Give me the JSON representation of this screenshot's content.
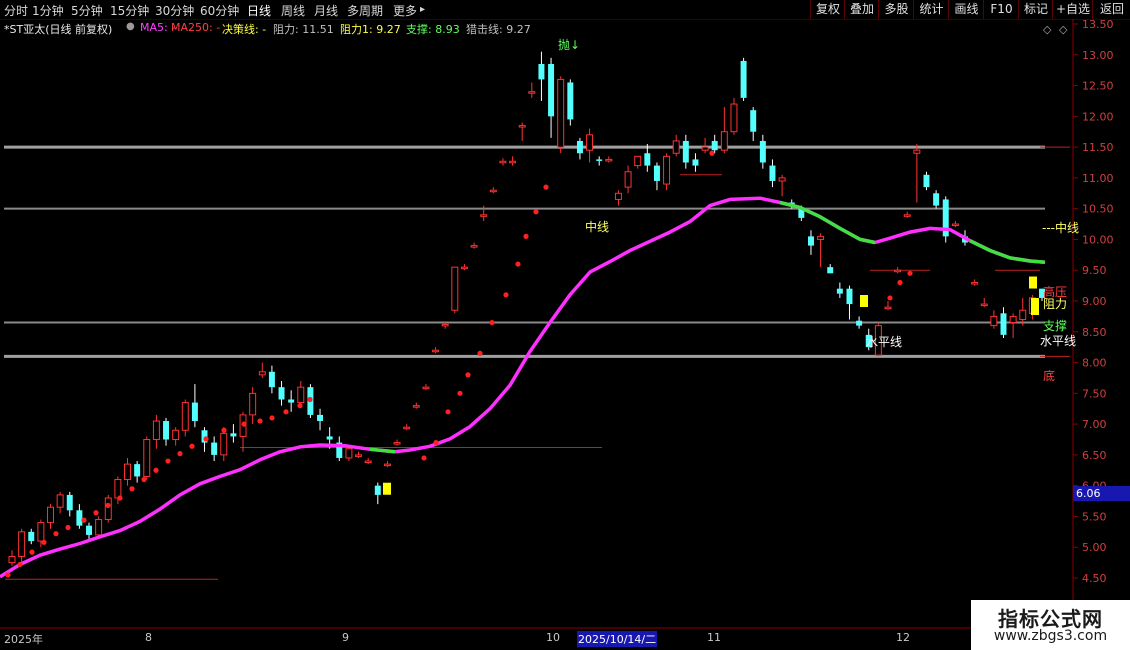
{
  "toolbar": {
    "timeframes": [
      "分时",
      "1分钟",
      "5分钟",
      "15分钟",
      "30分钟",
      "60分钟",
      "日线",
      "周线",
      "月线",
      "多周期",
      "更多"
    ],
    "active": "日线",
    "more_arrow": "▸",
    "right_buttons": [
      "复权",
      "叠加",
      "多股",
      "统计",
      "画线",
      "F10",
      "标记",
      "+自选",
      "返回"
    ]
  },
  "legend": {
    "stock": "*ST亚太(日线 前复权)",
    "ma5_label": "MA5: -",
    "ma250_label": "MA250: -",
    "decision_label": "决策线: -",
    "resist_label": "阻力: 11.51",
    "resist1_label": "阻力1: 9.27",
    "support_label": "支撑: 8.93",
    "snipe_label": "猎击线: 9.27"
  },
  "colors": {
    "background": "#000000",
    "up": "#ff3232",
    "down": "#54ffff",
    "ma": "#ff30ff",
    "ma_green": "#40e040",
    "hline": "#9a9a9a",
    "axis": "#8b0000",
    "yellow": "#ffff00"
  },
  "annotations": {
    "top_marker": "抛↓",
    "mid_line_label": "中线",
    "mid_line_right": "---中线",
    "level_label": "水平线",
    "level_right": "水平线",
    "high_press": "高压",
    "resist_right": "阻力",
    "support_right": "支撑",
    "bottom_right": "底"
  },
  "price_box": "6.06",
  "watermark": {
    "title": "指标公式网",
    "url": "www.zbgs3.com"
  },
  "x_axis": {
    "labels": [
      "2025年",
      "8",
      "9",
      "10",
      "11",
      "12"
    ],
    "highlight": "2025/10/14/二"
  },
  "chart_data": {
    "type": "candlestick",
    "y_ticks": [
      "13.50",
      "13.00",
      "12.50",
      "12.00",
      "11.50",
      "11.00",
      "10.50",
      "10.00",
      "9.50",
      "9.00",
      "8.50",
      "8.00",
      "7.50",
      "7.00",
      "6.50",
      "6.00",
      "5.50",
      "5.00",
      "4.50"
    ],
    "ylim": [
      4.3,
      13.65
    ],
    "h_lines": [
      11.5,
      10.5,
      8.65,
      8.1
    ],
    "candles": [
      [
        4.75,
        4.85,
        4.7,
        4.95
      ],
      [
        4.85,
        5.25,
        4.7,
        5.3
      ],
      [
        5.25,
        5.1,
        5.05,
        5.3
      ],
      [
        5.1,
        5.4,
        5.0,
        5.45
      ],
      [
        5.4,
        5.65,
        5.3,
        5.7
      ],
      [
        5.65,
        5.85,
        5.55,
        5.9
      ],
      [
        5.85,
        5.6,
        5.5,
        5.9
      ],
      [
        5.6,
        5.35,
        5.3,
        5.7
      ],
      [
        5.35,
        5.2,
        5.1,
        5.4
      ],
      [
        5.2,
        5.45,
        5.15,
        5.5
      ],
      [
        5.45,
        5.8,
        5.4,
        5.85
      ],
      [
        5.8,
        6.1,
        5.7,
        6.15
      ],
      [
        6.1,
        6.35,
        6.0,
        6.45
      ],
      [
        6.35,
        6.15,
        6.05,
        6.4
      ],
      [
        6.15,
        6.75,
        6.1,
        6.8
      ],
      [
        6.75,
        7.05,
        6.6,
        7.15
      ],
      [
        7.05,
        6.75,
        6.65,
        7.1
      ],
      [
        6.75,
        6.9,
        6.65,
        6.95
      ],
      [
        6.9,
        7.35,
        6.8,
        7.4
      ],
      [
        7.35,
        7.05,
        6.95,
        7.65
      ],
      [
        6.9,
        6.7,
        6.55,
        6.95
      ],
      [
        6.7,
        6.5,
        6.4,
        6.8
      ],
      [
        6.5,
        6.85,
        6.4,
        6.95
      ],
      [
        6.85,
        6.8,
        6.7,
        7.0
      ],
      [
        6.8,
        7.15,
        6.55,
        7.2
      ],
      [
        7.15,
        7.5,
        7.0,
        7.6
      ],
      [
        7.8,
        7.85,
        7.75,
        8.0
      ],
      [
        7.85,
        7.6,
        7.5,
        7.95
      ],
      [
        7.6,
        7.4,
        7.3,
        7.7
      ],
      [
        7.4,
        7.35,
        7.2,
        7.55
      ],
      [
        7.35,
        7.6,
        7.3,
        7.7
      ],
      [
        7.6,
        7.15,
        7.1,
        7.65
      ],
      [
        7.15,
        7.05,
        6.9,
        7.25
      ],
      [
        6.8,
        6.75,
        6.6,
        6.95
      ],
      [
        6.7,
        6.45,
        6.4,
        6.8
      ],
      [
        6.45,
        6.6,
        6.4,
        6.65
      ],
      [
        6.5,
        6.5,
        6.45,
        6.55
      ],
      [
        6.4,
        6.4,
        6.35,
        6.45
      ],
      [
        6.0,
        5.85,
        5.7,
        6.05
      ],
      [
        6.35,
        6.35,
        6.3,
        6.4
      ],
      [
        6.7,
        6.7,
        6.65,
        6.75
      ],
      [
        6.95,
        6.95,
        6.9,
        7.0
      ],
      [
        7.3,
        7.3,
        7.25,
        7.35
      ],
      [
        7.6,
        7.6,
        7.55,
        7.65
      ],
      [
        8.2,
        8.2,
        8.15,
        8.25
      ],
      [
        8.62,
        8.62,
        8.55,
        8.67
      ],
      [
        8.85,
        9.55,
        8.8,
        9.55
      ],
      [
        9.55,
        9.55,
        9.5,
        9.6
      ],
      [
        9.9,
        9.9,
        9.85,
        9.95
      ],
      [
        10.4,
        10.4,
        10.3,
        10.55
      ],
      [
        10.8,
        10.8,
        10.75,
        10.85
      ],
      [
        11.27,
        11.27,
        11.2,
        11.32
      ],
      [
        11.27,
        11.27,
        11.2,
        11.35
      ],
      [
        11.85,
        11.85,
        11.6,
        11.9
      ],
      [
        12.4,
        12.4,
        12.3,
        12.55
      ],
      [
        12.85,
        12.6,
        12.25,
        13.05
      ],
      [
        12.85,
        12.0,
        11.65,
        12.95
      ],
      [
        11.5,
        12.6,
        11.4,
        12.65
      ],
      [
        12.55,
        11.95,
        11.85,
        12.6
      ],
      [
        11.6,
        11.4,
        11.3,
        11.65
      ],
      [
        11.45,
        11.7,
        11.25,
        11.8
      ],
      [
        11.3,
        11.28,
        11.2,
        11.35
      ],
      [
        11.3,
        11.3,
        11.25,
        11.35
      ],
      [
        10.65,
        10.75,
        10.55,
        10.8
      ],
      [
        10.85,
        11.1,
        10.75,
        11.2
      ],
      [
        11.2,
        11.35,
        11.15,
        11.35
      ],
      [
        11.4,
        11.2,
        11.1,
        11.55
      ],
      [
        11.2,
        10.95,
        10.8,
        11.25
      ],
      [
        10.9,
        11.35,
        10.8,
        11.4
      ],
      [
        11.4,
        11.6,
        11.35,
        11.7
      ],
      [
        11.6,
        11.25,
        11.15,
        11.7
      ],
      [
        11.3,
        11.2,
        11.1,
        11.4
      ],
      [
        11.45,
        11.5,
        11.4,
        11.65
      ],
      [
        11.6,
        11.45,
        11.4,
        11.7
      ],
      [
        11.45,
        11.75,
        11.4,
        12.15
      ],
      [
        11.75,
        12.2,
        11.7,
        12.3
      ],
      [
        12.9,
        12.3,
        12.25,
        12.95
      ],
      [
        12.1,
        11.75,
        11.6,
        12.15
      ],
      [
        11.6,
        11.25,
        11.15,
        11.7
      ],
      [
        11.2,
        10.95,
        10.85,
        11.3
      ],
      [
        10.95,
        11.0,
        10.7,
        11.05
      ],
      [
        10.6,
        10.55,
        10.5,
        10.65
      ],
      [
        10.5,
        10.35,
        10.3,
        10.55
      ],
      [
        10.05,
        9.9,
        9.75,
        10.15
      ],
      [
        10.0,
        10.05,
        9.55,
        10.1
      ],
      [
        9.55,
        9.45,
        9.45,
        9.6
      ],
      [
        9.2,
        9.12,
        9.05,
        9.3
      ],
      [
        9.2,
        8.95,
        8.7,
        9.25
      ],
      [
        8.68,
        8.6,
        8.55,
        8.75
      ],
      [
        8.45,
        8.25,
        8.2,
        8.55
      ],
      [
        8.12,
        8.6,
        8.1,
        8.65
      ],
      [
        8.9,
        8.9,
        8.85,
        9.0
      ],
      [
        9.5,
        9.5,
        9.45,
        9.55
      ],
      [
        10.4,
        10.4,
        10.35,
        10.45
      ],
      [
        11.4,
        11.45,
        10.6,
        11.55
      ],
      [
        11.05,
        10.85,
        10.8,
        11.1
      ],
      [
        10.75,
        10.55,
        10.5,
        10.8
      ],
      [
        10.65,
        10.05,
        9.95,
        10.7
      ],
      [
        10.25,
        10.25,
        10.2,
        10.3
      ],
      [
        10.05,
        9.95,
        9.9,
        10.15
      ],
      [
        9.3,
        9.3,
        9.25,
        9.35
      ],
      [
        8.95,
        8.95,
        8.9,
        9.05
      ],
      [
        8.6,
        8.75,
        8.55,
        8.85
      ],
      [
        8.8,
        8.45,
        8.4,
        8.9
      ],
      [
        8.65,
        8.75,
        8.4,
        8.8
      ],
      [
        8.7,
        8.85,
        8.6,
        9.05
      ],
      [
        8.8,
        9.05,
        8.7,
        9.1
      ],
      [
        9.2,
        9.05,
        9.0,
        9.2
      ]
    ],
    "ma_line": [
      [
        0,
        4.52
      ],
      [
        20,
        4.72
      ],
      [
        40,
        4.87
      ],
      [
        60,
        4.97
      ],
      [
        80,
        5.06
      ],
      [
        100,
        5.17
      ],
      [
        120,
        5.27
      ],
      [
        140,
        5.42
      ],
      [
        160,
        5.62
      ],
      [
        180,
        5.85
      ],
      [
        200,
        6.03
      ],
      [
        220,
        6.15
      ],
      [
        240,
        6.26
      ],
      [
        260,
        6.42
      ],
      [
        280,
        6.55
      ],
      [
        300,
        6.63
      ],
      [
        320,
        6.66
      ],
      [
        345,
        6.65
      ],
      [
        370,
        6.59
      ],
      [
        395,
        6.55
      ],
      [
        410,
        6.58
      ],
      [
        430,
        6.64
      ],
      [
        450,
        6.76
      ],
      [
        470,
        6.96
      ],
      [
        490,
        7.25
      ],
      [
        510,
        7.63
      ],
      [
        530,
        8.18
      ],
      [
        550,
        8.65
      ],
      [
        570,
        9.1
      ],
      [
        590,
        9.47
      ],
      [
        610,
        9.64
      ],
      [
        630,
        9.82
      ],
      [
        650,
        9.97
      ],
      [
        670,
        10.12
      ],
      [
        690,
        10.29
      ],
      [
        710,
        10.55
      ],
      [
        730,
        10.65
      ],
      [
        760,
        10.67
      ],
      [
        780,
        10.6
      ],
      [
        800,
        10.52
      ],
      [
        820,
        10.37
      ],
      [
        840,
        10.18
      ],
      [
        860,
        10.0
      ],
      [
        875,
        9.95
      ],
      [
        890,
        10.02
      ],
      [
        910,
        10.12
      ],
      [
        930,
        10.18
      ],
      [
        950,
        10.16
      ],
      [
        970,
        9.98
      ],
      [
        990,
        9.82
      ],
      [
        1010,
        9.7
      ],
      [
        1030,
        9.65
      ],
      [
        1045,
        9.63
      ]
    ],
    "ma_green_ranges": [
      [
        355,
        395
      ],
      [
        775,
        880
      ],
      [
        955,
        1045
      ]
    ],
    "red_dots": [
      [
        8,
        4.55
      ],
      [
        20,
        4.72
      ],
      [
        32,
        4.92
      ],
      [
        44,
        5.08
      ],
      [
        56,
        5.22
      ],
      [
        68,
        5.32
      ],
      [
        84,
        5.44
      ],
      [
        96,
        5.56
      ],
      [
        108,
        5.68
      ],
      [
        120,
        5.8
      ],
      [
        132,
        5.95
      ],
      [
        144,
        6.1
      ],
      [
        156,
        6.25
      ],
      [
        168,
        6.4
      ],
      [
        180,
        6.52
      ],
      [
        192,
        6.64
      ],
      [
        206,
        6.76
      ],
      [
        224,
        6.9
      ],
      [
        244,
        7.0
      ],
      [
        260,
        7.05
      ],
      [
        272,
        7.1
      ],
      [
        286,
        7.2
      ],
      [
        300,
        7.3
      ],
      [
        310,
        7.4
      ],
      [
        424,
        6.45
      ],
      [
        436,
        6.7
      ],
      [
        448,
        7.2
      ],
      [
        460,
        7.5
      ],
      [
        468,
        7.8
      ],
      [
        480,
        8.15
      ],
      [
        492,
        8.65
      ],
      [
        506,
        9.1
      ],
      [
        518,
        9.6
      ],
      [
        526,
        10.05
      ],
      [
        536,
        10.45
      ],
      [
        546,
        10.85
      ],
      [
        712,
        11.4
      ],
      [
        890,
        9.05
      ],
      [
        900,
        9.3
      ],
      [
        910,
        9.45
      ]
    ],
    "yellow_markers": [
      [
        387,
        5.95
      ],
      [
        864,
        9.0
      ],
      [
        1033,
        9.3
      ]
    ],
    "red_hlines": [
      [
        5,
        218,
        4.48
      ],
      [
        240,
        602,
        6.62
      ],
      [
        680,
        722,
        11.05
      ],
      [
        870,
        930,
        9.5
      ],
      [
        995,
        1040,
        9.5
      ]
    ]
  }
}
